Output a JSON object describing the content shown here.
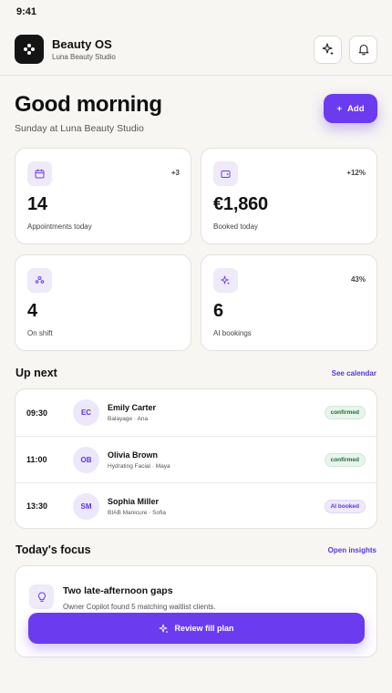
{
  "status_bar": {
    "time": "9:41"
  },
  "header": {
    "app_name": "Beauty OS",
    "studio_name": "Luna Beauty Studio",
    "icons": {
      "logo": "flower-icon",
      "ai": "sparkles-icon",
      "notifications": "bell-icon"
    }
  },
  "greeting": {
    "title": "Good morning",
    "subtitle": "Sunday at Luna Beauty Studio",
    "add_label": "Add"
  },
  "stats": [
    {
      "icon": "calendar-icon",
      "delta": "+3",
      "value": "14",
      "label": "Appointments today"
    },
    {
      "icon": "wallet-icon",
      "delta": "+12%",
      "value": "€1,860",
      "label": "Booked today"
    },
    {
      "icon": "team-icon",
      "delta": "",
      "value": "4",
      "label": "On shift"
    },
    {
      "icon": "sparkles-icon",
      "delta": "43%",
      "value": "6",
      "label": "AI bookings"
    }
  ],
  "up_next": {
    "title": "Up next",
    "link": "See calendar",
    "appointments": [
      {
        "time": "09:30",
        "initials": "EC",
        "name": "Emily Carter",
        "detail": "Balayage · Ana",
        "status": "confirmed"
      },
      {
        "time": "11:00",
        "initials": "OB",
        "name": "Olivia Brown",
        "detail": "Hydrating Facial · Maya",
        "status": "confirmed"
      },
      {
        "time": "13:30",
        "initials": "SM",
        "name": "Sophia Miller",
        "detail": "BIAB Manicure · Sofia",
        "status": "AI booked"
      }
    ]
  },
  "focus": {
    "title": "Today's focus",
    "link": "Open insights",
    "card_title": "Two late-afternoon gaps",
    "card_desc": "Owner Copilot found 5 matching waitlist clients.",
    "button_label": "Review fill plan",
    "icon": "lightbulb-icon"
  },
  "colors": {
    "accent": "#6b3bf0",
    "background": "#f7f6f3",
    "confirmed_text": "#236b3a",
    "confirmed_bg": "#e8f5ec"
  }
}
